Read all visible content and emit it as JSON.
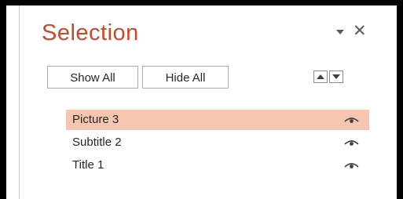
{
  "pane": {
    "title": "Selection",
    "menu_icon": "dropdown-arrow-icon",
    "close_icon": "close-icon",
    "close_glyph": "✕"
  },
  "toolbar": {
    "show_all_label": "Show All",
    "hide_all_label": "Hide All",
    "move_up_icon": "triangle-up-icon",
    "move_down_icon": "triangle-down-icon"
  },
  "items": [
    {
      "label": "Picture 3",
      "selected": true,
      "icon": "eye-icon"
    },
    {
      "label": "Subtitle 2",
      "selected": false,
      "icon": "eye-icon"
    },
    {
      "label": "Title 1",
      "selected": false,
      "icon": "eye-icon"
    }
  ],
  "colors": {
    "title": "#c8492b",
    "selected_row": "#f7c6b0",
    "text": "#262626"
  }
}
